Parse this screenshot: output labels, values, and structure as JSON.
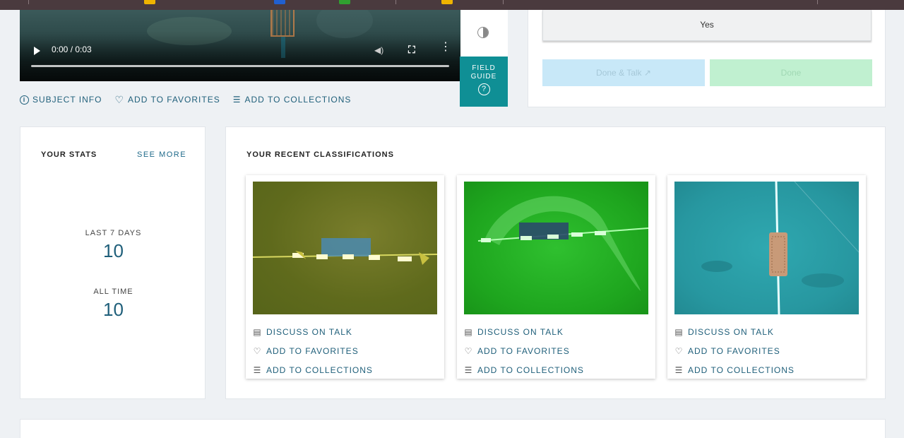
{
  "video": {
    "time": "0:00 / 0:03",
    "play_icon": "play-icon",
    "volume_icon": "volume-icon",
    "fullscreen_icon": "fullscreen-icon",
    "more_icon": "more-vertical-icon"
  },
  "side_tools": {
    "contrast_icon": "contrast-icon",
    "field_guide_label": "FIELD GUIDE",
    "field_guide_icon_glyph": "?"
  },
  "subject_actions": {
    "info_label": "SUBJECT INFO",
    "favorites_label": "ADD TO FAVORITES",
    "collections_label": "ADD TO COLLECTIONS"
  },
  "task": {
    "yes_label": "Yes",
    "done_talk_label": "Done & Talk",
    "done_label": "Done"
  },
  "stats": {
    "title": "YOUR STATS",
    "see_more": "SEE MORE",
    "last7_label": "LAST 7 DAYS",
    "last7_value": "10",
    "alltime_label": "ALL TIME",
    "alltime_value": "10"
  },
  "recent": {
    "title": "YOUR RECENT CLASSIFICATIONS",
    "items": [
      {
        "discuss": "DISCUSS ON TALK",
        "favorites": "ADD TO FAVORITES",
        "collections": "ADD TO COLLECTIONS"
      },
      {
        "discuss": "DISCUSS ON TALK",
        "favorites": "ADD TO FAVORITES",
        "collections": "ADD TO COLLECTIONS"
      },
      {
        "discuss": "DISCUSS ON TALK",
        "favorites": "ADD TO FAVORITES",
        "collections": "ADD TO COLLECTIONS"
      }
    ]
  },
  "colors": {
    "accent_teal": "#0f8f95",
    "link_blue": "#1f5f7a",
    "done_talk_bg": "#c8e8f8",
    "done_bg": "#c0f0d0"
  }
}
